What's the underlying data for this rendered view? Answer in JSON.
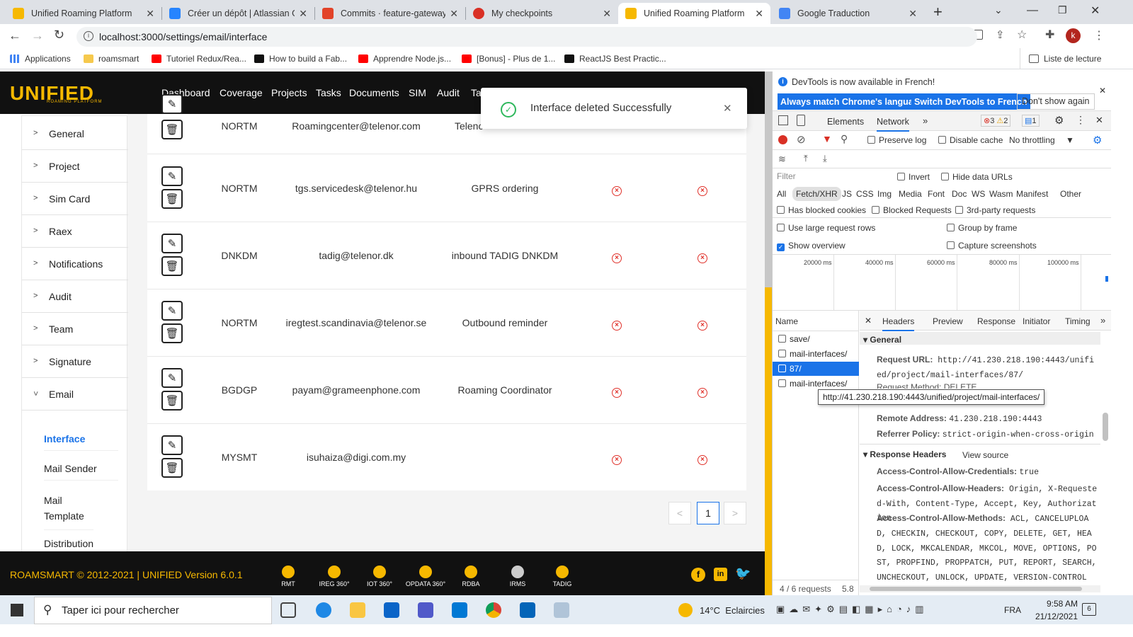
{
  "browser": {
    "tabs": [
      {
        "title": "Unified Roaming Platform",
        "icon": "unified-favicon",
        "color": "#f6b800"
      },
      {
        "title": "Créer un dépôt | Atlassian Git",
        "icon": "atlassian-favicon",
        "color": "#2684ff"
      },
      {
        "title": "Commits · feature-gateway-U",
        "icon": "gitlab-favicon",
        "color": "#e24329"
      },
      {
        "title": "My checkpoints",
        "icon": "checkpoints-favicon",
        "color": "#d93025"
      },
      {
        "title": "Unified Roaming Platform",
        "icon": "unified-favicon",
        "color": "#f6b800"
      },
      {
        "title": "Google Traduction",
        "icon": "translate-favicon",
        "color": "#4285f4"
      }
    ],
    "url": "localhost:3000/settings/email/interface",
    "profile_initial": "k",
    "bookmarks": [
      {
        "label": "Applications",
        "color": "#4285f4"
      },
      {
        "label": "roamsmart",
        "color": "#f6c94d"
      },
      {
        "label": "Tutoriel Redux/Rea...",
        "color": "#ff0000"
      },
      {
        "label": "How to build a Fab...",
        "color": "#111111"
      },
      {
        "label": "Apprendre Node.js...",
        "color": "#ff0000"
      },
      {
        "label": "[Bonus] - Plus de 1...",
        "color": "#ff0000"
      },
      {
        "label": "ReactJS Best Practic...",
        "color": "#111111"
      }
    ],
    "reading_list": "Liste de lecture"
  },
  "app": {
    "logo": "UNIFIED",
    "logo_sub": "ROAMING PLATFORM",
    "nav": [
      "Dashboard",
      "Coverage",
      "Projects",
      "Tasks",
      "Documents",
      "SIM",
      "Audit",
      "Ta"
    ],
    "sidebar": [
      {
        "label": "General"
      },
      {
        "label": "Project"
      },
      {
        "label": "Sim Card"
      },
      {
        "label": "Raex"
      },
      {
        "label": "Notifications"
      },
      {
        "label": "Audit"
      },
      {
        "label": "Team"
      },
      {
        "label": "Signature"
      },
      {
        "label": "Email"
      }
    ],
    "sidebar_sub": [
      "Interface",
      "Mail Sender",
      "Mail Template",
      "Distribution"
    ],
    "rows": [
      {
        "code": "NORTM",
        "email": "Roamingcenter@telenor.com",
        "desc": "Telenc",
        "flags": false
      },
      {
        "code": "NORTM",
        "email": "tgs.servicedesk@telenor.hu",
        "desc": "GPRS ordering",
        "flags": true
      },
      {
        "code": "DNKDM",
        "email": "tadig@telenor.dk",
        "desc": "inbound TADIG DNKDM",
        "flags": true
      },
      {
        "code": "NORTM",
        "email": "iregtest.scandinavia@telenor.se",
        "desc": "Outbound reminder",
        "flags": true
      },
      {
        "code": "BGDGP",
        "email": "payam@grameenphone.com",
        "desc": "Roaming Coordinator",
        "flags": true
      },
      {
        "code": "MYSMT",
        "email": "isuhaiza@digi.com.my",
        "desc": "",
        "flags": true
      }
    ],
    "pager": {
      "prev": "<",
      "current": "1",
      "next": ">"
    },
    "toast": "Interface deleted Successfully",
    "footer": {
      "copyright": "ROAMSMART © 2012-2021 | UNIFIED Version 6.0.1",
      "products": [
        "RMT",
        "IREG 360°",
        "IOT 360°",
        "OPDATA 360°",
        "RDBA",
        "IRMS",
        "TADIG"
      ]
    },
    "accent": "#f6b800"
  },
  "devtools": {
    "banner": "DevTools is now available in French!",
    "btn_match": "Always match Chrome's language",
    "btn_switch": "Switch DevTools to French",
    "btn_dismiss": "Don't show again",
    "tabs": [
      "Elements",
      "Network"
    ],
    "errors": "3",
    "warnings": "2",
    "messages": "1",
    "preserve_log": "Preserve log",
    "disable_cache": "Disable cache",
    "throttling": "No throttling",
    "filter_placeholder": "Filter",
    "invert": "Invert",
    "hide_data_urls": "Hide data URLs",
    "types": [
      "All",
      "Fetch/XHR",
      "JS",
      "CSS",
      "Img",
      "Media",
      "Font",
      "Doc",
      "WS",
      "Wasm",
      "Manifest",
      "Other"
    ],
    "has_blocked": "Has blocked cookies",
    "blocked_requests": "Blocked Requests",
    "third_party": "3rd-party requests",
    "large_rows": "Use large request rows",
    "group_by_frame": "Group by frame",
    "show_overview": "Show overview",
    "capture_screenshots": "Capture screenshots",
    "timeline": [
      "20000 ms",
      "40000 ms",
      "60000 ms",
      "80000 ms",
      "100000 ms"
    ],
    "name_header": "Name",
    "requests": [
      "save/",
      "mail-interfaces/",
      "87/",
      "mail-interfaces/"
    ],
    "detail_tabs": [
      "Headers",
      "Preview",
      "Response",
      "Initiator",
      "Timing"
    ],
    "general": "General",
    "request_url_label": "Request URL:",
    "request_url": "http://41.230.218.190:4443/unified/project/mail-interfaces/87/",
    "request_method_partial": "Request Method: DELETE",
    "tooltip": "http://41.230.218.190:4443/unified/project/mail-interfaces/",
    "remote_label": "Remote Address:",
    "remote": "41.230.218.190:4443",
    "referrer_label": "Referrer Policy:",
    "referrer": "strict-origin-when-cross-origin",
    "resp_headers": "Response Headers",
    "view_source": "View source",
    "acac_label": "Access-Control-Allow-Credentials:",
    "acac": "true",
    "acah_label": "Access-Control-Allow-Headers:",
    "acah": "Origin, X-Requested-With, Content-Type, Accept, Key, Authorization",
    "acam_label": "Access-Control-Allow-Methods:",
    "acam": "ACL, CANCELUPLOAD, CHECKIN, CHECKOUT, COPY, DELETE, GET, HEAD, LOCK, MKCALENDAR, MKCOL, MOVE, OPTIONS, POST, PROPFIND, PROPPATCH, PUT, REPORT, SEARCH, UNCHECKOUT, UNLOCK, UPDATE, VERSION-CONTROL",
    "status": "4 / 6 requests",
    "status_size": "5.8"
  },
  "taskbar": {
    "search_placeholder": "Taper ici pour rechercher",
    "weather": "14°C  Eclaircies",
    "lang": "FRA",
    "time": "9:58 AM",
    "date": "21/12/2021",
    "notifications": "6"
  }
}
